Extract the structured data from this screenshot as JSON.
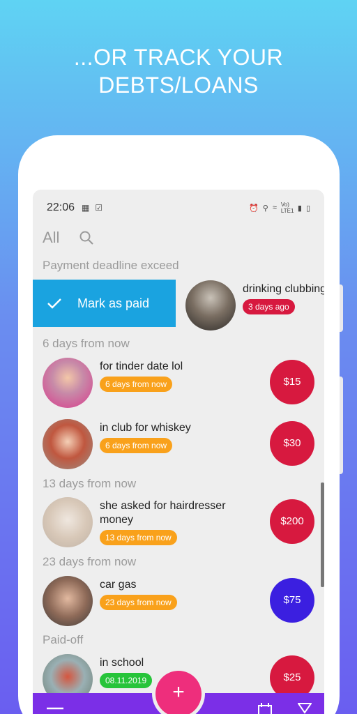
{
  "headline": {
    "line1": "...OR TRACK YOUR",
    "line2": "DEBTS/LOANS"
  },
  "status_bar": {
    "time": "22:06",
    "network": "Vo) LTE1"
  },
  "filter": {
    "label": "All"
  },
  "sections": {
    "overdue": "Payment deadline exceed",
    "six_days": "6 days from now",
    "thirteen_days": "13 days from now",
    "twentythree_days": "23 days from now",
    "paid_off": "Paid-off"
  },
  "swipe_action": {
    "label": "Mark as paid"
  },
  "items": [
    {
      "title": "drinking clubbing",
      "badge": "3 days ago",
      "badge_color": "#d7193f",
      "amount": ""
    },
    {
      "title": "for tinder date lol",
      "badge": "6 days from now",
      "badge_color": "#f9a11b",
      "amount": "$15",
      "amount_color": "#d7193f"
    },
    {
      "title": "in club for whiskey",
      "badge": "6 days from now",
      "badge_color": "#f9a11b",
      "amount": "$30",
      "amount_color": "#d7193f"
    },
    {
      "title": "she asked for hairdresser money",
      "badge": "13 days from now",
      "badge_color": "#f9a11b",
      "amount": "$200",
      "amount_color": "#d7193f"
    },
    {
      "title": "car gas",
      "badge": "23 days from now",
      "badge_color": "#f9a11b",
      "amount": "$75",
      "amount_color": "#3b1fe0"
    },
    {
      "title": "in school",
      "badge": "08.11.2019",
      "badge_color": "#27c43a",
      "amount": "$25",
      "amount_color": "#d7193f"
    }
  ],
  "fab": {
    "label": "+"
  }
}
